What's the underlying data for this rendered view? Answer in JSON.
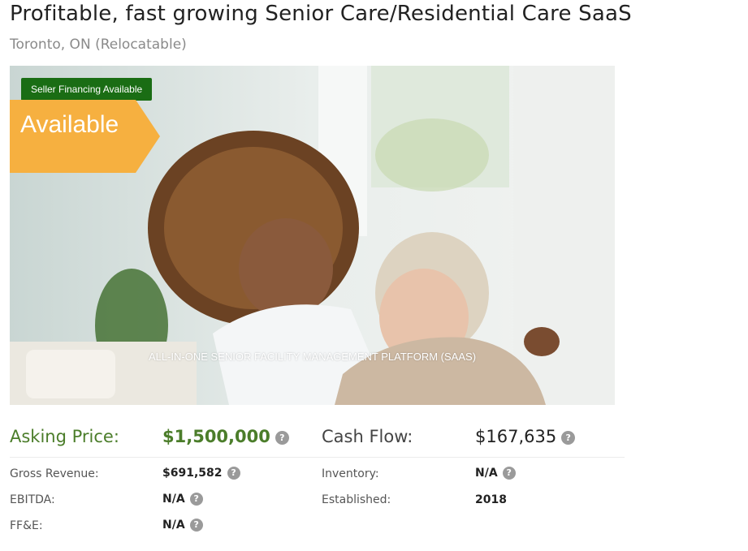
{
  "listing": {
    "title": "Profitable, fast growing Senior Care/Residential Care SaaS",
    "location": "Toronto, ON (Relocatable)"
  },
  "hero": {
    "badge": "Seller Financing Available",
    "banner": "Available",
    "caption": "ALL-IN-ONE SENIOR FACILITY MANAGEMENT PLATFORM (SAAS)"
  },
  "financials": {
    "asking_price_label": "Asking Price:",
    "asking_price_value": "$1,500,000",
    "cash_flow_label": "Cash Flow:",
    "cash_flow_value": "$167,635",
    "gross_revenue_label": "Gross Revenue:",
    "gross_revenue_value": "$691,582",
    "inventory_label": "Inventory:",
    "inventory_value": "N/A",
    "ebitda_label": "EBITDA:",
    "ebitda_value": "N/A",
    "established_label": "Established:",
    "established_value": "2018",
    "ffe_label": "FF&E:",
    "ffe_value": "N/A"
  },
  "help_glyph": "?",
  "colors": {
    "accent_green": "#4b7d2a",
    "badge_green": "#1a6d14",
    "banner_orange": "#f6b040",
    "help_gray": "#9a9a9a"
  }
}
